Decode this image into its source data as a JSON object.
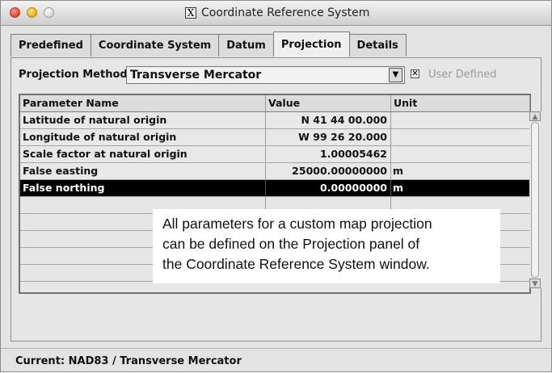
{
  "window": {
    "title": "Coordinate Reference System"
  },
  "tabs": [
    {
      "label": "Predefined"
    },
    {
      "label": "Coordinate System"
    },
    {
      "label": "Datum"
    },
    {
      "label": "Projection"
    },
    {
      "label": "Details"
    }
  ],
  "active_tab": "Projection",
  "projection_method": {
    "label": "Projection Method",
    "value": "Transverse Mercator"
  },
  "user_defined": {
    "label": "User Defined",
    "checked": true
  },
  "table": {
    "headers": [
      "Parameter Name",
      "Value",
      "Unit"
    ],
    "rows": [
      {
        "name": "Latitude of natural origin",
        "value": "N 41 44 00.000",
        "unit": ""
      },
      {
        "name": "Longitude of natural origin",
        "value": "W 99 26 20.000",
        "unit": ""
      },
      {
        "name": "Scale factor at natural origin",
        "value": "1.00005462",
        "unit": ""
      },
      {
        "name": "False easting",
        "value": "25000.00000000",
        "unit": "m"
      },
      {
        "name": "False northing",
        "value": "0.00000000",
        "unit": "m"
      }
    ]
  },
  "callout": {
    "line1": "All parameters for a custom map projection",
    "line2": "can be defined on the Projection panel of",
    "line3": "the Coordinate Reference System window."
  },
  "status": {
    "text": "Current: NAD83 / Transverse Mercator"
  },
  "colors": {
    "selected_row": "#000000",
    "selected_text": "#ffffff",
    "background": "#e3e3e3"
  }
}
